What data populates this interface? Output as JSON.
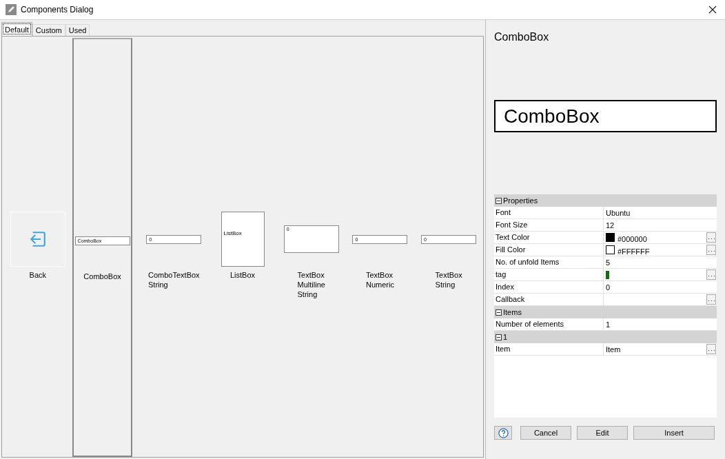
{
  "window": {
    "title": "Components Dialog"
  },
  "tabs": [
    {
      "label": "Default",
      "selected": true
    },
    {
      "label": "Custom",
      "selected": false
    },
    {
      "label": "Used",
      "selected": false
    }
  ],
  "components": [
    {
      "kind": "back",
      "label": "Back",
      "selected": false
    },
    {
      "kind": "combobox",
      "label": "ComboBox",
      "preview": "ComboBox",
      "selected": true
    },
    {
      "kind": "textbox",
      "label": "ComboTextBox\nString",
      "preview": "0",
      "selected": false
    },
    {
      "kind": "listbox",
      "label": "ListBox",
      "preview": "ListBox",
      "selected": false
    },
    {
      "kind": "multiline",
      "label": "TextBox\nMultiline\nString",
      "preview": "0",
      "selected": false
    },
    {
      "kind": "textbox",
      "label": "TextBox\nNumeric",
      "preview": "0",
      "selected": false
    },
    {
      "kind": "textbox",
      "label": "TextBox\nString",
      "preview": "0",
      "selected": false
    }
  ],
  "details": {
    "title": "ComboBox",
    "preview": "ComboBox"
  },
  "properties": [
    {
      "kind": "group",
      "label": "Properties"
    },
    {
      "kind": "prop",
      "name": "Font",
      "value": "Ubuntu",
      "button": false
    },
    {
      "kind": "prop",
      "name": "Font Size",
      "value": "12",
      "button": false
    },
    {
      "kind": "color-prop",
      "name": "Text Color",
      "value": "#000000",
      "color": "#000000",
      "button": true
    },
    {
      "kind": "color-prop",
      "name": "Fill Color",
      "value": "#FFFFFF",
      "color": "#ffffff",
      "button": true
    },
    {
      "kind": "prop",
      "name": "No. of unfold Items",
      "value": "5",
      "button": false
    },
    {
      "kind": "tag-prop",
      "name": "tag",
      "color": "#107010",
      "button": true
    },
    {
      "kind": "prop",
      "name": "Index",
      "value": "0",
      "button": false
    },
    {
      "kind": "prop",
      "name": "Callback",
      "button": true
    },
    {
      "kind": "group",
      "label": "Items"
    },
    {
      "kind": "prop",
      "name": "Number of elements",
      "value": "1",
      "button": false
    },
    {
      "kind": "group",
      "label": "1"
    },
    {
      "kind": "prop",
      "name": "Item",
      "value": "Item",
      "button": true
    }
  ],
  "buttons": [
    {
      "kind": "help"
    },
    {
      "kind": "text",
      "label": "Cancel"
    },
    {
      "kind": "text",
      "label": "Edit"
    },
    {
      "kind": "text",
      "label": "Insert"
    }
  ]
}
